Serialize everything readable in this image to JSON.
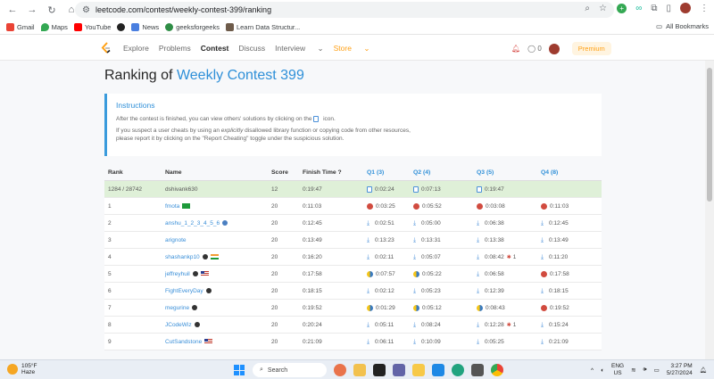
{
  "browser": {
    "url": "leetcode.com/contest/weekly-contest-399/ranking",
    "bookmarks": [
      "Gmail",
      "Maps",
      "YouTube",
      "News",
      "geeksforgeeks",
      "Learn Data Structur..."
    ],
    "all_bookmarks": "All Bookmarks"
  },
  "nav": {
    "links": [
      "Explore",
      "Problems",
      "Contest",
      "Discuss",
      "Interview",
      "Store"
    ],
    "notifications": "0",
    "premium": "Premium"
  },
  "page": {
    "title_prefix": "Ranking of",
    "title_contest": "Weekly Contest 399",
    "instructions": {
      "title": "Instructions",
      "line1": "After the contest is finished, you can view others' solutions by clicking on the",
      "line1_end": "icon.",
      "line2a": "If you suspect a user cheats by using an",
      "line2b": "explicitly",
      "line2c": "disallowed library function or copying code from other resources,",
      "line3": "please report it by clicking on the \"Report Cheating\" toggle under the suspicious solution."
    }
  },
  "table": {
    "headers": {
      "rank": "Rank",
      "name": "Name",
      "score": "Score",
      "finish": "Finish Time",
      "q1": "Q1 (3)",
      "q2": "Q2 (4)",
      "q3": "Q3 (5)",
      "q4": "Q4 (8)"
    },
    "rows": [
      {
        "rank": "1284 / 28742",
        "name": "dshivank630",
        "score": "12",
        "finish": "0:19:47",
        "q1": "0:02:24",
        "q2": "0:07:13",
        "q3": "0:19:47",
        "q4": ""
      },
      {
        "rank": "1",
        "name": "fmota",
        "score": "20",
        "finish": "0:11:03",
        "q1": "0:03:25",
        "q2": "0:05:52",
        "q3": "0:03:08",
        "q4": "0:11:03"
      },
      {
        "rank": "2",
        "name": "anshu_1_2_3_4_5_6",
        "score": "20",
        "finish": "0:12:45",
        "q1": "0:02:51",
        "q2": "0:05:00",
        "q3": "0:06:38",
        "q4": "0:12:45"
      },
      {
        "rank": "3",
        "name": "arignote",
        "score": "20",
        "finish": "0:13:49",
        "q1": "0:13:23",
        "q2": "0:13:31",
        "q3": "0:13:38",
        "q4": "0:13:49"
      },
      {
        "rank": "4",
        "name": "shashankp10",
        "score": "20",
        "finish": "0:16:20",
        "q1": "0:02:11",
        "q2": "0:05:07",
        "q3": "0:08:42",
        "q3_extra": "1",
        "q4": "0:11:20"
      },
      {
        "rank": "5",
        "name": "jeffreyhuil",
        "score": "20",
        "finish": "0:17:58",
        "q1": "0:07:57",
        "q2": "0:05:22",
        "q3": "0:06:58",
        "q4": "0:17:58"
      },
      {
        "rank": "6",
        "name": "FightEveryDay",
        "score": "20",
        "finish": "0:18:15",
        "q1": "0:02:12",
        "q2": "0:05:23",
        "q3": "0:12:39",
        "q4": "0:18:15"
      },
      {
        "rank": "7",
        "name": "megurine",
        "score": "20",
        "finish": "0:19:52",
        "q1": "0:01:29",
        "q2": "0:05:12",
        "q3": "0:08:43",
        "q4": "0:19:52"
      },
      {
        "rank": "8",
        "name": "JCodeWiz",
        "score": "20",
        "finish": "0:20:24",
        "q1": "0:05:11",
        "q2": "0:08:24",
        "q3": "0:12:28",
        "q3_extra": "1",
        "q4": "0:15:24"
      },
      {
        "rank": "9",
        "name": "CutSandstone",
        "score": "20",
        "finish": "0:21:09",
        "q1": "0:06:11",
        "q2": "0:10:09",
        "q3": "0:05:25",
        "q4": "0:21:09"
      }
    ]
  },
  "taskbar": {
    "temp": "105°F",
    "cond": "Haze",
    "search": "Search",
    "lang": "ENG",
    "region": "US",
    "time": "3:27 PM",
    "date": "5/27/2024"
  }
}
